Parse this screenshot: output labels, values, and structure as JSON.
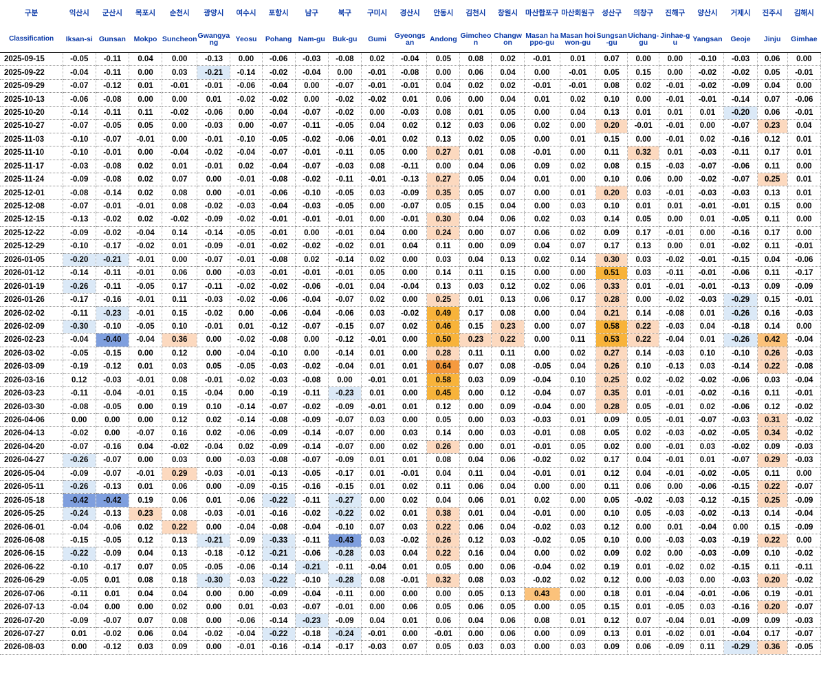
{
  "chart_data": {
    "type": "table",
    "header_kr": [
      "구분",
      "익산시",
      "군산시",
      "목포시",
      "순천시",
      "광양시",
      "여수시",
      "포항시",
      "남구",
      "북구",
      "구미시",
      "경산시",
      "안동시",
      "김천시",
      "창원시",
      "마산합포구",
      "마산회원구",
      "성산구",
      "의창구",
      "진해구",
      "양산시",
      "거제시",
      "진주시",
      "김해시"
    ],
    "header_en": [
      "Classification",
      "Iksan-si",
      "Gunsan",
      "Mokpo",
      "Suncheon",
      "Gwangyang",
      "Yeosu",
      "Pohang",
      "Nam-gu",
      "Buk-gu",
      "Gumi",
      "Gyeongsan",
      "Andong",
      "Gimcheon",
      "Changwon",
      "Masan happo-gu",
      "Masan hoiwon-gu",
      "Sungsan-gu",
      "Uichang-gu",
      "Jinhae-gu",
      "Yangsan",
      "Geoje",
      "Jinju",
      "Gimhae"
    ],
    "rows": [
      [
        "2025-09-15",
        "-0.05",
        "-0.11",
        "0.04",
        "0.00",
        "-0.13",
        "0.00",
        "-0.06",
        "-0.03",
        "-0.08",
        "0.02",
        "-0.04",
        "0.05",
        "0.08",
        "0.02",
        "-0.01",
        "0.01",
        "0.07",
        "0.00",
        "0.00",
        "-0.10",
        "-0.03",
        "0.06",
        "0.00"
      ],
      [
        "2025-09-22",
        "-0.04",
        "-0.11",
        "0.00",
        "0.03",
        "-0.21",
        "-0.14",
        "-0.02",
        "-0.04",
        "0.00",
        "-0.01",
        "-0.08",
        "0.00",
        "0.06",
        "0.04",
        "0.00",
        "-0.01",
        "0.05",
        "0.15",
        "0.00",
        "-0.02",
        "-0.02",
        "0.05",
        "-0.01"
      ],
      [
        "2025-09-29",
        "-0.07",
        "-0.12",
        "0.01",
        "-0.01",
        "-0.01",
        "-0.06",
        "-0.04",
        "0.00",
        "-0.07",
        "-0.01",
        "-0.01",
        "0.04",
        "0.02",
        "0.02",
        "-0.01",
        "-0.01",
        "0.08",
        "0.02",
        "-0.01",
        "-0.02",
        "-0.09",
        "0.04",
        "0.00"
      ],
      [
        "2025-10-13",
        "-0.06",
        "-0.08",
        "0.00",
        "0.00",
        "0.01",
        "-0.02",
        "-0.02",
        "0.00",
        "-0.02",
        "-0.02",
        "0.01",
        "0.06",
        "0.00",
        "0.04",
        "0.01",
        "0.02",
        "0.10",
        "0.00",
        "-0.01",
        "-0.01",
        "-0.14",
        "0.07",
        "-0.06"
      ],
      [
        "2025-10-20",
        "-0.14",
        "-0.11",
        "0.11",
        "-0.02",
        "-0.06",
        "0.00",
        "-0.04",
        "-0.07",
        "-0.02",
        "0.00",
        "-0.03",
        "0.08",
        "0.01",
        "0.05",
        "0.00",
        "0.04",
        "0.13",
        "0.01",
        "0.01",
        "0.01",
        "-0.20",
        "0.06",
        "-0.01"
      ],
      [
        "2025-10-27",
        "-0.07",
        "-0.05",
        "0.05",
        "0.00",
        "-0.03",
        "0.00",
        "-0.07",
        "-0.11",
        "-0.05",
        "0.04",
        "0.02",
        "0.12",
        "0.03",
        "0.06",
        "0.02",
        "0.00",
        "0.20",
        "-0.01",
        "-0.01",
        "0.00",
        "-0.07",
        "0.23",
        "0.04"
      ],
      [
        "2025-11-03",
        "-0.10",
        "-0.07",
        "-0.01",
        "0.00",
        "-0.01",
        "-0.10",
        "-0.05",
        "-0.02",
        "-0.06",
        "-0.01",
        "0.02",
        "0.13",
        "0.02",
        "0.05",
        "0.00",
        "0.01",
        "0.15",
        "0.00",
        "-0.01",
        "0.02",
        "-0.16",
        "0.12",
        "0.01"
      ],
      [
        "2025-11-10",
        "-0.10",
        "-0.01",
        "0.00",
        "-0.04",
        "-0.02",
        "-0.04",
        "-0.07",
        "-0.01",
        "-0.11",
        "0.05",
        "0.00",
        "0.27",
        "0.01",
        "0.08",
        "-0.01",
        "0.00",
        "0.11",
        "0.32",
        "0.01",
        "-0.03",
        "-0.11",
        "0.17",
        "0.01"
      ],
      [
        "2025-11-17",
        "-0.03",
        "-0.08",
        "0.02",
        "0.01",
        "-0.01",
        "0.02",
        "-0.04",
        "-0.07",
        "-0.03",
        "0.08",
        "-0.11",
        "0.00",
        "0.04",
        "0.06",
        "0.09",
        "0.02",
        "0.08",
        "0.15",
        "-0.03",
        "-0.07",
        "-0.06",
        "0.11",
        "0.00"
      ],
      [
        "2025-11-24",
        "-0.09",
        "-0.08",
        "0.02",
        "0.07",
        "0.00",
        "-0.01",
        "-0.08",
        "-0.02",
        "-0.11",
        "-0.01",
        "-0.13",
        "0.27",
        "0.05",
        "0.04",
        "0.01",
        "0.00",
        "0.10",
        "0.06",
        "0.00",
        "-0.02",
        "-0.07",
        "0.25",
        "0.01"
      ],
      [
        "2025-12-01",
        "-0.08",
        "-0.14",
        "0.02",
        "0.08",
        "0.00",
        "-0.01",
        "-0.06",
        "-0.10",
        "-0.05",
        "0.03",
        "-0.09",
        "0.35",
        "0.05",
        "0.07",
        "0.00",
        "0.01",
        "0.20",
        "0.03",
        "-0.01",
        "-0.03",
        "-0.03",
        "0.13",
        "0.01"
      ],
      [
        "2025-12-08",
        "-0.07",
        "-0.01",
        "-0.01",
        "0.08",
        "-0.02",
        "-0.03",
        "-0.04",
        "-0.03",
        "-0.05",
        "0.00",
        "-0.07",
        "0.05",
        "0.15",
        "0.04",
        "0.00",
        "0.03",
        "0.10",
        "0.01",
        "0.01",
        "-0.01",
        "-0.01",
        "0.15",
        "0.00"
      ],
      [
        "2025-12-15",
        "-0.13",
        "-0.02",
        "0.02",
        "-0.02",
        "-0.09",
        "-0.02",
        "-0.01",
        "-0.01",
        "-0.01",
        "0.00",
        "-0.01",
        "0.30",
        "0.04",
        "0.06",
        "0.02",
        "0.03",
        "0.14",
        "0.05",
        "0.00",
        "0.01",
        "-0.05",
        "0.11",
        "0.00"
      ],
      [
        "2025-12-22",
        "-0.09",
        "-0.02",
        "-0.04",
        "0.14",
        "-0.14",
        "-0.05",
        "-0.01",
        "0.00",
        "-0.01",
        "0.04",
        "0.00",
        "0.24",
        "0.00",
        "0.07",
        "0.06",
        "0.02",
        "0.09",
        "0.17",
        "-0.01",
        "0.00",
        "-0.16",
        "0.17",
        "0.00"
      ],
      [
        "2025-12-29",
        "-0.10",
        "-0.17",
        "-0.02",
        "0.01",
        "-0.09",
        "-0.01",
        "-0.02",
        "-0.02",
        "-0.02",
        "0.01",
        "0.04",
        "0.11",
        "0.00",
        "0.09",
        "0.04",
        "0.07",
        "0.17",
        "0.13",
        "0.00",
        "0.01",
        "-0.02",
        "0.11",
        "-0.01"
      ],
      [
        "2026-01-05",
        "-0.20",
        "-0.21",
        "-0.01",
        "0.00",
        "-0.07",
        "-0.01",
        "-0.08",
        "0.02",
        "-0.14",
        "0.02",
        "0.00",
        "0.03",
        "0.04",
        "0.13",
        "0.02",
        "0.14",
        "0.30",
        "0.03",
        "-0.02",
        "-0.01",
        "-0.15",
        "0.04",
        "-0.06"
      ],
      [
        "2026-01-12",
        "-0.14",
        "-0.11",
        "-0.01",
        "0.06",
        "0.00",
        "-0.03",
        "-0.01",
        "-0.01",
        "-0.01",
        "0.05",
        "0.00",
        "0.14",
        "0.11",
        "0.15",
        "0.00",
        "0.00",
        "0.51",
        "0.03",
        "-0.11",
        "-0.01",
        "-0.06",
        "0.11",
        "-0.17"
      ],
      [
        "2026-01-19",
        "-0.26",
        "-0.11",
        "-0.05",
        "0.17",
        "-0.11",
        "-0.02",
        "-0.02",
        "-0.06",
        "-0.01",
        "0.04",
        "-0.04",
        "0.13",
        "0.03",
        "0.12",
        "0.02",
        "0.06",
        "0.33",
        "0.01",
        "-0.01",
        "-0.01",
        "-0.13",
        "0.09",
        "-0.09"
      ],
      [
        "2026-01-26",
        "-0.17",
        "-0.16",
        "-0.01",
        "0.11",
        "-0.03",
        "-0.02",
        "-0.06",
        "-0.04",
        "-0.07",
        "0.02",
        "0.00",
        "0.25",
        "0.01",
        "0.13",
        "0.06",
        "0.17",
        "0.28",
        "0.00",
        "-0.02",
        "-0.03",
        "-0.29",
        "0.15",
        "-0.01"
      ],
      [
        "2026-02-02",
        "-0.11",
        "-0.23",
        "-0.01",
        "0.15",
        "-0.02",
        "0.00",
        "-0.06",
        "-0.04",
        "-0.06",
        "0.03",
        "-0.02",
        "0.49",
        "0.17",
        "0.08",
        "0.00",
        "0.04",
        "0.21",
        "0.14",
        "-0.08",
        "0.01",
        "-0.26",
        "0.16",
        "-0.03"
      ],
      [
        "2026-02-09",
        "-0.30",
        "-0.10",
        "-0.05",
        "0.10",
        "-0.01",
        "0.01",
        "-0.12",
        "-0.07",
        "-0.15",
        "0.07",
        "0.02",
        "0.46",
        "0.15",
        "0.23",
        "0.00",
        "0.07",
        "0.58",
        "0.22",
        "-0.03",
        "0.04",
        "-0.18",
        "0.14",
        "0.00"
      ],
      [
        "2026-02-23",
        "-0.04",
        "-0.40",
        "-0.04",
        "0.36",
        "0.00",
        "-0.02",
        "-0.08",
        "0.00",
        "-0.12",
        "-0.01",
        "0.00",
        "0.50",
        "0.23",
        "0.22",
        "0.00",
        "0.11",
        "0.53",
        "0.22",
        "-0.04",
        "0.01",
        "-0.26",
        "0.42",
        "-0.04"
      ],
      [
        "2026-03-02",
        "-0.05",
        "-0.15",
        "0.00",
        "0.12",
        "0.00",
        "-0.04",
        "-0.10",
        "0.00",
        "-0.14",
        "0.01",
        "0.00",
        "0.28",
        "0.11",
        "0.11",
        "0.00",
        "0.02",
        "0.27",
        "0.14",
        "-0.03",
        "0.10",
        "-0.10",
        "0.26",
        "-0.03"
      ],
      [
        "2026-03-09",
        "-0.19",
        "-0.12",
        "0.01",
        "0.03",
        "0.05",
        "-0.05",
        "-0.03",
        "-0.02",
        "-0.04",
        "0.01",
        "0.01",
        "0.64",
        "0.07",
        "0.08",
        "-0.05",
        "0.04",
        "0.26",
        "0.10",
        "-0.13",
        "0.03",
        "-0.14",
        "0.22",
        "-0.08"
      ],
      [
        "2026-03-16",
        "0.12",
        "-0.03",
        "-0.01",
        "0.08",
        "-0.01",
        "-0.02",
        "-0.03",
        "-0.08",
        "0.00",
        "-0.01",
        "0.01",
        "0.58",
        "0.03",
        "0.09",
        "-0.04",
        "0.10",
        "0.25",
        "0.02",
        "-0.02",
        "-0.02",
        "-0.06",
        "0.03",
        "-0.04"
      ],
      [
        "2026-03-23",
        "-0.11",
        "-0.04",
        "-0.01",
        "0.15",
        "-0.04",
        "0.00",
        "-0.19",
        "-0.11",
        "-0.23",
        "0.01",
        "0.00",
        "0.45",
        "0.00",
        "0.12",
        "-0.04",
        "0.07",
        "0.35",
        "0.01",
        "-0.01",
        "-0.02",
        "-0.16",
        "0.11",
        "-0.01"
      ],
      [
        "2026-03-30",
        "-0.08",
        "-0.05",
        "0.00",
        "0.19",
        "0.10",
        "-0.14",
        "-0.07",
        "-0.02",
        "-0.09",
        "-0.01",
        "0.01",
        "0.12",
        "0.00",
        "0.09",
        "-0.04",
        "0.00",
        "0.28",
        "0.05",
        "-0.01",
        "0.02",
        "-0.06",
        "0.12",
        "-0.02"
      ],
      [
        "2026-04-06",
        "0.00",
        "0.00",
        "0.00",
        "0.12",
        "0.02",
        "-0.14",
        "-0.08",
        "-0.09",
        "-0.07",
        "0.03",
        "0.00",
        "0.05",
        "0.00",
        "0.03",
        "-0.03",
        "0.01",
        "0.09",
        "0.05",
        "-0.01",
        "-0.07",
        "-0.03",
        "0.31",
        "-0.02"
      ],
      [
        "2026-04-13",
        "-0.02",
        "0.00",
        "-0.07",
        "0.16",
        "0.02",
        "-0.06",
        "-0.09",
        "-0.14",
        "-0.07",
        "0.00",
        "0.03",
        "0.14",
        "0.00",
        "0.03",
        "-0.01",
        "0.08",
        "0.05",
        "0.02",
        "-0.03",
        "-0.02",
        "-0.05",
        "0.34",
        "-0.02"
      ],
      [
        "2026-04-20",
        "-0.07",
        "-0.16",
        "0.04",
        "-0.02",
        "-0.04",
        "0.02",
        "-0.09",
        "-0.14",
        "-0.07",
        "0.00",
        "0.02",
        "0.26",
        "0.00",
        "0.01",
        "-0.01",
        "0.05",
        "0.02",
        "0.00",
        "-0.01",
        "0.03",
        "-0.02",
        "0.09",
        "-0.03"
      ],
      [
        "2026-04-27",
        "-0.26",
        "-0.07",
        "0.00",
        "0.03",
        "0.00",
        "-0.03",
        "-0.08",
        "-0.07",
        "-0.09",
        "0.01",
        "0.01",
        "0.08",
        "0.04",
        "0.06",
        "-0.02",
        "0.02",
        "0.17",
        "0.04",
        "-0.01",
        "0.01",
        "-0.07",
        "0.29",
        "-0.03"
      ],
      [
        "2026-05-04",
        "-0.09",
        "-0.07",
        "-0.01",
        "0.29",
        "-0.03",
        "-0.01",
        "-0.13",
        "-0.05",
        "-0.17",
        "0.01",
        "-0.01",
        "0.04",
        "0.11",
        "0.04",
        "-0.01",
        "0.01",
        "0.12",
        "0.04",
        "-0.01",
        "-0.02",
        "-0.05",
        "0.11",
        "0.00"
      ],
      [
        "2026-05-11",
        "-0.26",
        "-0.13",
        "0.01",
        "0.06",
        "0.00",
        "-0.09",
        "-0.15",
        "-0.16",
        "-0.15",
        "0.01",
        "0.02",
        "0.11",
        "0.06",
        "0.04",
        "0.00",
        "0.00",
        "0.11",
        "0.06",
        "0.00",
        "-0.06",
        "-0.15",
        "0.22",
        "-0.07"
      ],
      [
        "2026-05-18",
        "-0.42",
        "-0.42",
        "0.19",
        "0.06",
        "0.01",
        "-0.06",
        "-0.22",
        "-0.11",
        "-0.27",
        "0.00",
        "0.02",
        "0.04",
        "0.06",
        "0.01",
        "0.02",
        "0.00",
        "0.05",
        "-0.02",
        "-0.03",
        "-0.12",
        "-0.15",
        "0.25",
        "-0.09"
      ],
      [
        "2026-05-25",
        "-0.24",
        "-0.13",
        "0.23",
        "0.08",
        "-0.03",
        "-0.01",
        "-0.16",
        "-0.02",
        "-0.22",
        "0.02",
        "0.01",
        "0.38",
        "0.01",
        "0.04",
        "-0.01",
        "0.00",
        "0.10",
        "0.05",
        "-0.03",
        "-0.02",
        "-0.13",
        "0.14",
        "-0.04"
      ],
      [
        "2026-06-01",
        "-0.04",
        "-0.06",
        "0.02",
        "0.22",
        "0.00",
        "-0.04",
        "-0.08",
        "-0.04",
        "-0.10",
        "0.07",
        "0.03",
        "0.22",
        "0.06",
        "0.04",
        "-0.02",
        "0.03",
        "0.12",
        "0.00",
        "0.01",
        "-0.04",
        "0.00",
        "0.15",
        "-0.09"
      ],
      [
        "2026-06-08",
        "-0.15",
        "-0.05",
        "0.12",
        "0.13",
        "-0.21",
        "-0.09",
        "-0.33",
        "-0.11",
        "-0.43",
        "0.03",
        "-0.02",
        "0.26",
        "0.12",
        "0.03",
        "-0.02",
        "0.05",
        "0.10",
        "0.00",
        "-0.03",
        "-0.03",
        "-0.19",
        "0.22",
        "0.00"
      ],
      [
        "2026-06-15",
        "-0.22",
        "-0.09",
        "0.04",
        "0.13",
        "-0.18",
        "-0.12",
        "-0.21",
        "-0.06",
        "-0.28",
        "0.03",
        "0.04",
        "0.22",
        "0.16",
        "0.04",
        "0.00",
        "0.02",
        "0.09",
        "0.02",
        "0.00",
        "-0.03",
        "-0.09",
        "0.10",
        "-0.02"
      ],
      [
        "2026-06-22",
        "-0.10",
        "-0.17",
        "0.07",
        "0.05",
        "-0.05",
        "-0.06",
        "-0.14",
        "-0.21",
        "-0.11",
        "-0.04",
        "0.01",
        "0.05",
        "0.00",
        "0.06",
        "-0.04",
        "0.02",
        "0.19",
        "0.01",
        "-0.02",
        "0.02",
        "-0.15",
        "0.11",
        "-0.11"
      ],
      [
        "2026-06-29",
        "-0.05",
        "0.01",
        "0.08",
        "0.18",
        "-0.30",
        "-0.03",
        "-0.22",
        "-0.10",
        "-0.28",
        "0.08",
        "-0.01",
        "0.32",
        "0.08",
        "0.03",
        "-0.02",
        "0.02",
        "0.12",
        "0.00",
        "-0.03",
        "0.00",
        "-0.03",
        "0.20",
        "-0.02"
      ],
      [
        "2026-07-06",
        "-0.11",
        "0.01",
        "0.04",
        "0.04",
        "0.00",
        "0.00",
        "-0.09",
        "-0.04",
        "-0.11",
        "0.00",
        "0.00",
        "0.00",
        "0.05",
        "0.13",
        "0.43",
        "0.00",
        "0.18",
        "0.01",
        "-0.04",
        "-0.01",
        "-0.06",
        "0.19",
        "-0.01"
      ],
      [
        "2026-07-13",
        "-0.04",
        "0.00",
        "0.00",
        "0.02",
        "0.00",
        "0.01",
        "-0.03",
        "-0.07",
        "-0.01",
        "0.00",
        "0.06",
        "0.05",
        "0.06",
        "0.05",
        "0.00",
        "0.05",
        "0.15",
        "0.01",
        "-0.05",
        "0.03",
        "-0.16",
        "0.20",
        "-0.07"
      ],
      [
        "2026-07-20",
        "-0.09",
        "-0.07",
        "0.07",
        "0.08",
        "0.00",
        "-0.06",
        "-0.14",
        "-0.23",
        "-0.09",
        "0.04",
        "0.01",
        "0.06",
        "0.04",
        "0.06",
        "0.08",
        "0.01",
        "0.12",
        "0.07",
        "-0.04",
        "0.01",
        "-0.09",
        "0.09",
        "-0.03"
      ],
      [
        "2026-07-27",
        "0.01",
        "-0.02",
        "0.06",
        "0.04",
        "-0.02",
        "-0.04",
        "-0.22",
        "-0.18",
        "-0.24",
        "-0.01",
        "0.00",
        "-0.01",
        "0.00",
        "0.06",
        "0.00",
        "0.09",
        "0.13",
        "0.01",
        "-0.02",
        "0.01",
        "-0.04",
        "0.17",
        "-0.07"
      ],
      [
        "2026-08-03",
        "0.00",
        "-0.12",
        "0.03",
        "0.09",
        "0.00",
        "-0.01",
        "-0.16",
        "-0.14",
        "-0.17",
        "-0.03",
        "0.07",
        "0.05",
        "0.03",
        "0.03",
        "0.00",
        "0.03",
        "0.09",
        "0.06",
        "-0.09",
        "0.11",
        "-0.29",
        "0.36",
        "-0.05"
      ]
    ]
  }
}
